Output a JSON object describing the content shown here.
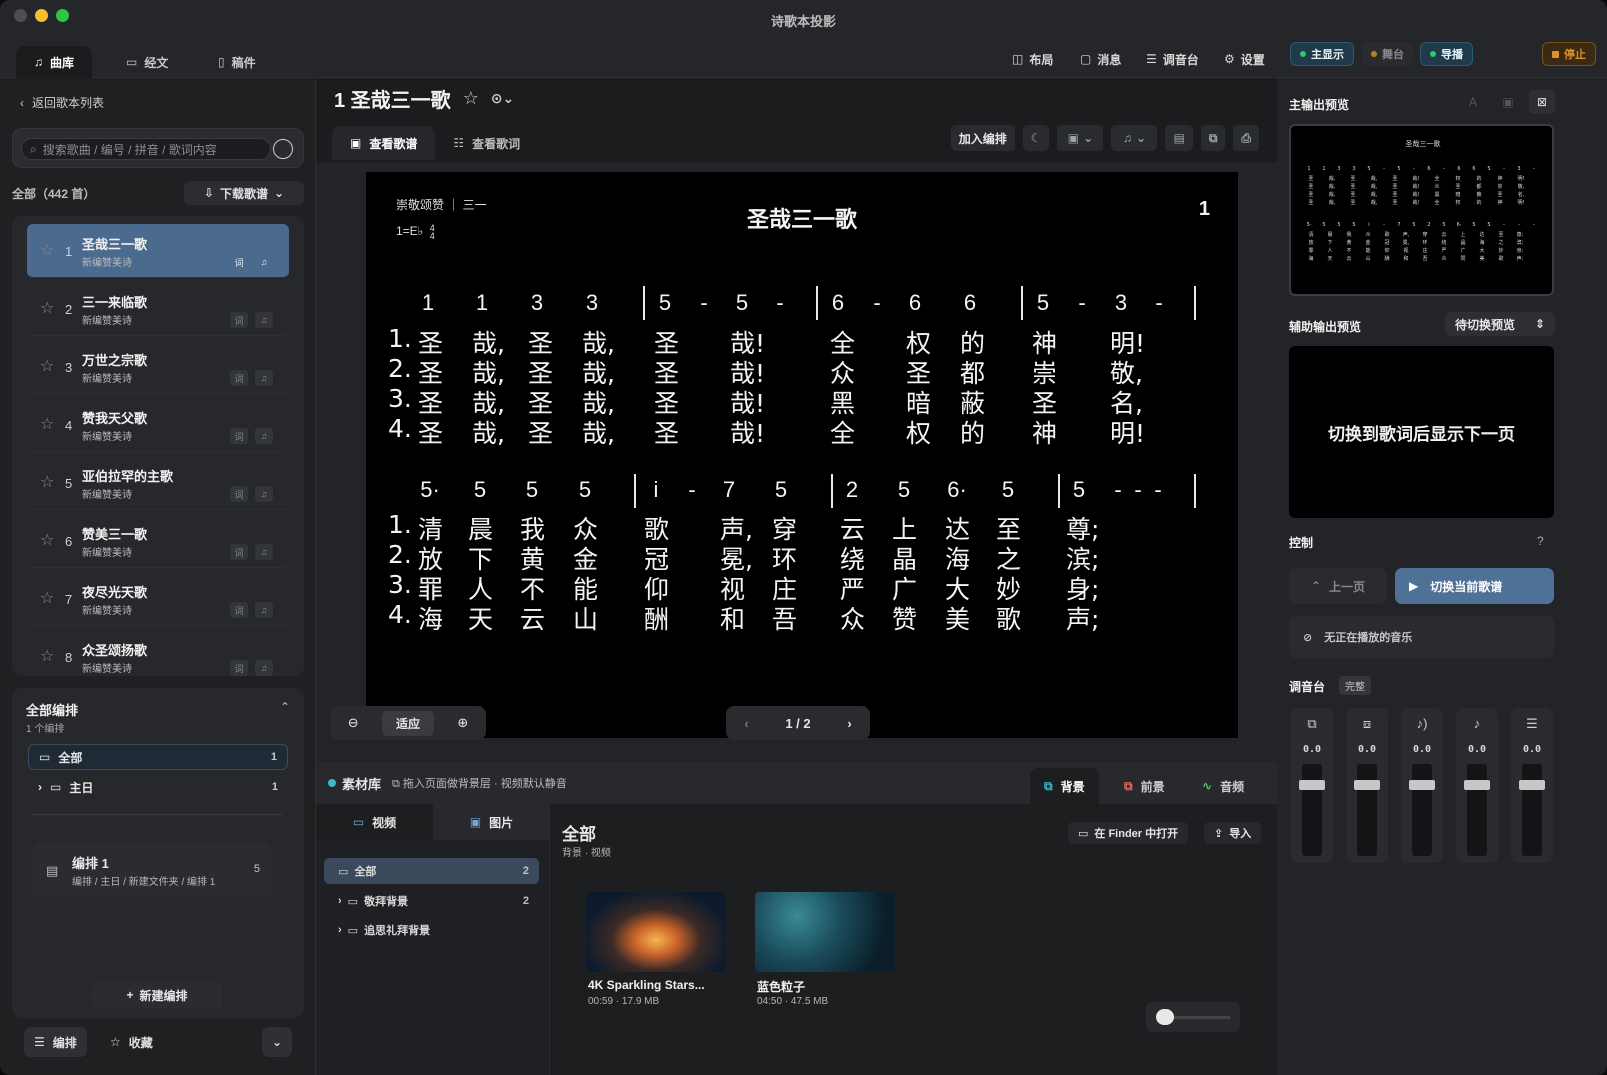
{
  "window": {
    "title": "诗歌本投影"
  },
  "colors": {
    "accent": "#4a6a8e",
    "green": "#31c96a",
    "stop": "#e0902a",
    "bg": "#1e1f21"
  },
  "top_tabs": [
    {
      "label": "曲库",
      "icon": "music-list-icon"
    },
    {
      "label": "经文",
      "icon": "book-icon"
    },
    {
      "label": "稿件",
      "icon": "document-icon"
    }
  ],
  "toolbar": {
    "layout": "布局",
    "message": "消息",
    "mixer": "调音台",
    "settings": "设置"
  },
  "status": {
    "main_display": "主显示",
    "stage": "舞台",
    "guide": "导播",
    "stop": "停止"
  },
  "left": {
    "back": "返回歌本列表",
    "search_placeholder": "搜索歌曲 / 编号 / 拼音 / 歌词内容",
    "count": "全部（442 首）",
    "download": "下载歌谱",
    "songs": [
      {
        "num": "1",
        "name": "圣哉三一歌",
        "book": "新编赞美诗",
        "b1": "词"
      },
      {
        "num": "2",
        "name": "三一来临歌",
        "book": "新编赞美诗",
        "b1": "词"
      },
      {
        "num": "3",
        "name": "万世之宗歌",
        "book": "新编赞美诗",
        "b1": "词"
      },
      {
        "num": "4",
        "name": "赞我天父歌",
        "book": "新编赞美诗",
        "b1": "词"
      },
      {
        "num": "5",
        "name": "亚伯拉罕的主歌",
        "book": "新编赞美诗",
        "b1": "词"
      },
      {
        "num": "6",
        "name": "赞美三一歌",
        "book": "新编赞美诗",
        "b1": "词"
      },
      {
        "num": "7",
        "name": "夜尽光天歌",
        "book": "新编赞美诗",
        "b1": "词"
      },
      {
        "num": "8",
        "name": "众圣颂扬歌",
        "book": "新编赞美诗",
        "b1": "词"
      }
    ],
    "arrange": {
      "title": "全部编排",
      "subtitle": "1 个编排",
      "all": {
        "label": "全部",
        "count": "1"
      },
      "sunday": {
        "label": "主日",
        "count": "1"
      },
      "item": {
        "title": "编排 1",
        "path": "编排 / 主日 / 新建文件夹 / 编排 1",
        "count": "5"
      },
      "new": "新建编排"
    },
    "bottom": {
      "arrange": "编排",
      "favorite": "收藏"
    }
  },
  "center": {
    "song_title": "1 圣哉三一歌",
    "tabs": [
      "查看歌谱",
      "查看歌词"
    ],
    "add_arrange": "加入编排",
    "sheet": {
      "meta": "崇敬颂赞 ｜ 三一",
      "key": "1=E♭",
      "time_top": "4",
      "time_bottom": "4",
      "title": "圣哉三一歌",
      "number": "1",
      "notes1": [
        "1",
        "1",
        "3",
        "3",
        "5",
        "-",
        "5",
        "-",
        "6",
        "-",
        "6",
        "6",
        "5",
        "-",
        "3",
        "-"
      ],
      "lyrics1": [
        [
          "1.",
          "圣",
          "哉,",
          "圣",
          "哉,",
          "圣",
          "哉!",
          "全",
          "权",
          "的",
          "神",
          "明!"
        ],
        [
          "2.",
          "圣",
          "哉,",
          "圣",
          "哉,",
          "圣",
          "哉!",
          "众",
          "圣",
          "都",
          "崇",
          "敬,"
        ],
        [
          "3.",
          "圣",
          "哉,",
          "圣",
          "哉,",
          "圣",
          "哉!",
          "黑",
          "暗",
          "蔽",
          "圣",
          "名,"
        ],
        [
          "4.",
          "圣",
          "哉,",
          "圣",
          "哉,",
          "圣",
          "哉!",
          "全",
          "权",
          "的",
          "神",
          "明!"
        ]
      ],
      "notes2": [
        "5·",
        "5",
        "5",
        "5",
        "i",
        "-",
        "7",
        "5",
        "2",
        "5",
        "6·",
        "5",
        "5",
        "-",
        "-",
        "-"
      ],
      "lyrics2": [
        [
          "1.",
          "清",
          "晨",
          "我",
          "众",
          "歌",
          "声,",
          "穿",
          "云",
          "上",
          "达",
          "至",
          "尊;"
        ],
        [
          "2.",
          "放",
          "下",
          "黄",
          "金",
          "冠",
          "冕,",
          "环",
          "绕",
          "晶",
          "海",
          "之",
          "滨;"
        ],
        [
          "3.",
          "罪",
          "人",
          "不",
          "能",
          "仰",
          "视",
          "庄",
          "严",
          "广",
          "大",
          "妙",
          "身;"
        ],
        [
          "4.",
          "海",
          "天",
          "云",
          "山",
          "酬",
          "和",
          "吾",
          "众",
          "赞",
          "美",
          "歌",
          "声;"
        ]
      ]
    },
    "zoom_fit": "适应",
    "pager": "1 / 2",
    "materials": {
      "title": "素材库",
      "hint": "拖入页面做背景层 · 视频默认静音",
      "tabs": [
        "背景",
        "前景",
        "音频"
      ],
      "media_tabs": [
        "视频",
        "图片"
      ],
      "folders": [
        {
          "label": "全部",
          "count": "2"
        },
        {
          "label": "敬拜背景",
          "count": "2"
        },
        {
          "label": "追思礼拜背景",
          "count": ""
        }
      ],
      "heading": "全部",
      "sub": "背景 · 视频",
      "finder": "在 Finder 中打开",
      "import": "导入",
      "items": [
        {
          "name": "4K Sparkling Stars...",
          "meta": "00:59 · 17.9 MB"
        },
        {
          "name": "蓝色粒子",
          "meta": "04:50 · 47.5 MB"
        }
      ]
    }
  },
  "right": {
    "main_preview": "主输出预览",
    "aux_preview": "辅助输出预览",
    "aux_select": "待切换预览",
    "aux_text": "切换到歌词后显示下一页",
    "control": "控制",
    "prev_page": "上一页",
    "switch_lyrics": "切换当前歌谱",
    "no_music": "无正在播放的音乐",
    "mixer": "调音台",
    "mixer_badge": "完整",
    "channels": [
      {
        "icon": "copy-icon",
        "value": "0.0"
      },
      {
        "icon": "duplicate-icon",
        "value": "0.0"
      },
      {
        "icon": "speaker-icon",
        "value": "0.0"
      },
      {
        "icon": "music-note-icon",
        "value": "0.0"
      },
      {
        "icon": "sliders-icon",
        "value": "0.0"
      }
    ]
  }
}
